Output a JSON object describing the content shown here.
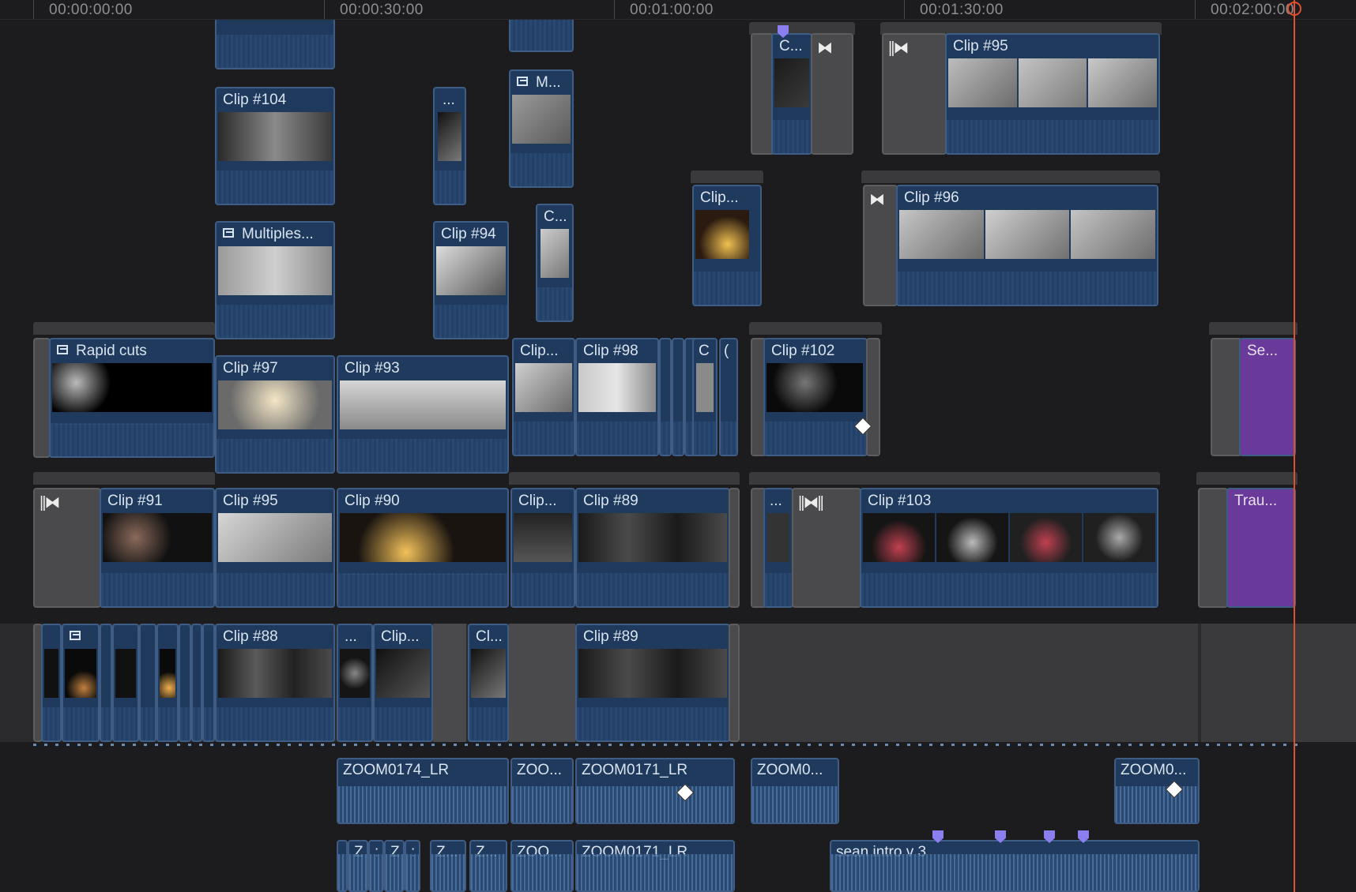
{
  "ruler": {
    "t0": "00:00:00:00",
    "t1": "00:00:30:00",
    "t2": "00:01:00:00",
    "t3": "00:01:30:00",
    "t4": "00:02:00:00"
  },
  "clips": {
    "c104": "Clip #104",
    "c_ellipsis": "...",
    "m_ellipsis": "M...",
    "c_short": "C...",
    "clip95_top": "Clip #95",
    "multiples": "Multiples...",
    "c94": "Clip #94",
    "c_short2": "C...",
    "clip_short": "Clip...",
    "c96": "Clip #96",
    "rapid": "Rapid cuts",
    "c97": "Clip #97",
    "c93": "Clip #93",
    "clip_short2": "Clip...",
    "c98": "Clip #98",
    "c_letter": "C",
    "c_paren": "(",
    "c102": "Clip #102",
    "se": "Se...",
    "c91": "Clip #91",
    "c95b": "Clip #95",
    "c90": "Clip #90",
    "clip_short3": "Clip...",
    "c89": "Clip #89",
    "dots": "...",
    "c103": "Clip #103",
    "trau": "Trau...",
    "c88": "Clip #88",
    "dots2": "...",
    "clip_short4": "Clip...",
    "cl": "Cl...",
    "c89b": "Clip #89"
  },
  "audio": {
    "a1": "ZOOM0174_LR",
    "a2": "ZOO...",
    "a3": "ZOOM0171_LR",
    "a4": "ZOOM0...",
    "a5": "ZOOM0...",
    "b1": "Z",
    "b2": ":",
    "b3": "Z",
    "b4": ":",
    "b5": "Z...",
    "b6": "Z...",
    "b7": "ZOO...",
    "b8": "ZOOM0171_LR",
    "b9": "sean intro v 3"
  },
  "colors": {
    "clip": "#1f3a5c",
    "generator": "#6a3a9a",
    "playhead": "#e0502e",
    "marker": "#8b7ff0"
  }
}
